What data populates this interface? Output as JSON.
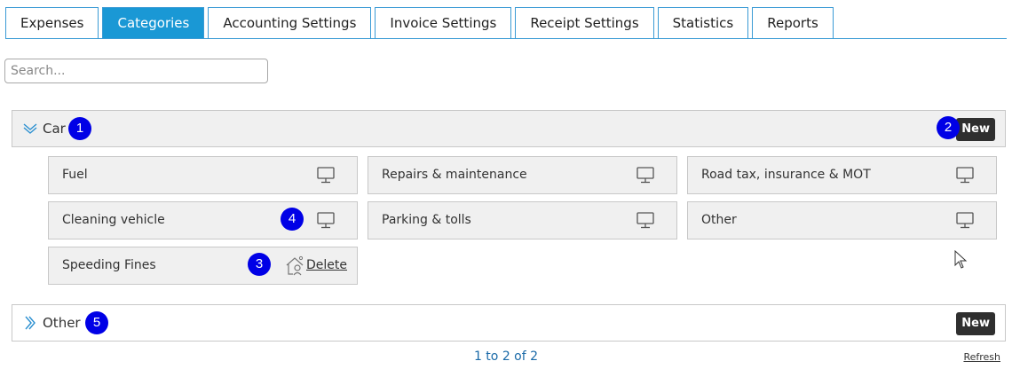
{
  "tabs": [
    {
      "label": "Expenses",
      "active": false
    },
    {
      "label": "Categories",
      "active": true
    },
    {
      "label": "Accounting Settings",
      "active": false
    },
    {
      "label": "Invoice Settings",
      "active": false
    },
    {
      "label": "Receipt Settings",
      "active": false
    },
    {
      "label": "Statistics",
      "active": false
    },
    {
      "label": "Reports",
      "active": false
    }
  ],
  "search": {
    "placeholder": "Search...",
    "value": ""
  },
  "groups": [
    {
      "name": "Car",
      "expanded": true,
      "new_label": "New",
      "items": [
        {
          "name": "Fuel",
          "icon": "monitor-icon"
        },
        {
          "name": "Repairs & maintenance",
          "icon": "monitor-icon"
        },
        {
          "name": "Road tax, insurance & MOT",
          "icon": "monitor-icon"
        },
        {
          "name": "Cleaning vehicle",
          "icon": "monitor-icon"
        },
        {
          "name": "Parking & tolls",
          "icon": "monitor-icon"
        },
        {
          "name": "Other",
          "icon": "monitor-icon"
        },
        {
          "name": "Speeding Fines",
          "icon": "non-deductible-icon",
          "delete_label": "Delete"
        }
      ]
    },
    {
      "name": "Other",
      "expanded": false,
      "new_label": "New",
      "items": []
    }
  ],
  "badges": [
    "1",
    "2",
    "3",
    "4",
    "5"
  ],
  "footer": {
    "pagination": "1 to 2 of 2",
    "refresh_label": "Refresh"
  },
  "colors": {
    "tab_active": "#1a98d5",
    "badge": "#0000e6",
    "new_button": "#2f2f2f",
    "pager_text": "#1a6aa8"
  }
}
